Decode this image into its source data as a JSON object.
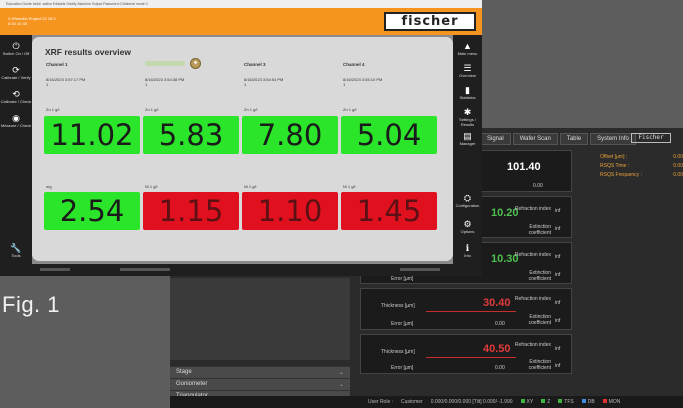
{
  "figure_label": "Fig. 1",
  "foreground": {
    "top_strip": "Education  Guide  #### -active                                                                                                            Editable  Oddity  Machine  Output  Password  0   Material mode  0",
    "header_datetime": [
      "C:\\Results\\  Project 22 18 0",
      "0:33 10 45"
    ],
    "logo_text": "fischer",
    "left_sidebar": [
      {
        "icon": "power-icon",
        "glyph": "⏻",
        "label": "Switch On / Off"
      },
      {
        "icon": "calibrate-icon",
        "glyph": "⟳",
        "label": "Calibrate / Verify"
      },
      {
        "icon": "calibrate-check-icon",
        "glyph": "⟲",
        "label": "Calibrate / Check"
      },
      {
        "icon": "measure-icon",
        "glyph": "◉",
        "label": "Measure / Check"
      },
      {
        "icon": "wrench-icon",
        "glyph": "🔧",
        "label": "Tools"
      }
    ],
    "right_sidebar": [
      {
        "icon": "main-menu-icon",
        "glyph": "▲",
        "label": "Main menu"
      },
      {
        "icon": "list-icon",
        "glyph": "☰",
        "label": "Overview"
      },
      {
        "icon": "chart-icon",
        "glyph": "▮",
        "label": "Statistics"
      },
      {
        "icon": "settings-icon",
        "glyph": "✱",
        "label": "Settings / Results"
      },
      {
        "icon": "save-icon",
        "glyph": "▤",
        "label": "Manager"
      },
      {
        "icon": "configuration-icon",
        "glyph": "⛭",
        "label": "Configuration"
      },
      {
        "icon": "gear-icon",
        "glyph": "⚙",
        "label": "Options"
      },
      {
        "icon": "info-icon",
        "glyph": "ℹ",
        "label": "Info"
      }
    ],
    "results": {
      "title": "XRF results overview",
      "channels": [
        {
          "name": "Channel 1",
          "date": "8/16/2023 3:57:17 PM",
          "index": "1"
        },
        {
          "name": "",
          "date": "8/16/2023 3:54:38 PM",
          "index": "1"
        },
        {
          "name": "Channel 3",
          "date": "8/16/2023 3:54:54 PM",
          "index": "1"
        },
        {
          "name": "Channel 4",
          "date": "8/16/2023 3:55:10 PM",
          "index": "1"
        }
      ],
      "row1": [
        {
          "label": "Zn 1   g/l",
          "value": "11.02",
          "status": "green"
        },
        {
          "label": "Zn 1   g/l",
          "value": "5.83",
          "status": "green"
        },
        {
          "label": "Zn 1   g/l",
          "value": "7.80",
          "status": "green"
        },
        {
          "label": "Zn 1   g/l",
          "value": "5.04",
          "status": "green"
        }
      ],
      "row2": [
        {
          "label": "mg",
          "value": "2.54",
          "status": "green"
        },
        {
          "label": "Ni 1   g/l",
          "value": "1.15",
          "status": "red"
        },
        {
          "label": "Ni 1   g/l",
          "value": "1.10",
          "status": "red"
        },
        {
          "label": "Ni 1   g/l",
          "value": "1.45",
          "status": "red"
        }
      ]
    },
    "colors": {
      "header": "#f59520",
      "ok": "#2be52b",
      "fail": "#e1101e"
    }
  },
  "background": {
    "tabs": [
      "Signal",
      "Wafer Scan",
      "Table",
      "System Info"
    ],
    "logo_text": "Fischer",
    "info": [
      {
        "label": "Offset [µm] :",
        "value": "0.00"
      },
      {
        "label": "RSQS Time :",
        "value": "0.00"
      },
      {
        "label": "RSQS Frequency :",
        "value": "0.00"
      }
    ],
    "cards": [
      {
        "big": "101.40",
        "small": "0.00"
      },
      {
        "value": "10.20",
        "color": "green",
        "lbl1": "Refraction index",
        "u1": "inf",
        "lbl2": "Extinction coefficient",
        "u2": "inf"
      },
      {
        "value": "10.30",
        "color": "green",
        "thick": "",
        "err": "Error [µm]",
        "lbl1": "Refraction index",
        "u1": "inf",
        "lbl2": "Extinction coefficient",
        "u2": "inf"
      },
      {
        "value": "30.40",
        "color": "red",
        "thick": "Thickness [µm]",
        "err": "Error [µm]",
        "errval": "0.00",
        "lbl1": "Refraction index",
        "u1": "inf",
        "lbl2": "Extinction coefficient",
        "u2": "inf"
      },
      {
        "value": "40.50",
        "color": "red",
        "thick": "Thickness [µm]",
        "err": "Error [µm]",
        "errval": "0.00",
        "lbl1": "Refraction index",
        "u1": "inf",
        "lbl2": "Extinction coefficient",
        "u2": "inf"
      }
    ],
    "accordion": [
      "Stage",
      "Goniometer",
      "Triangulator"
    ],
    "status": {
      "user_role_label": "User Role :",
      "user_role": "Customer",
      "coords": "0.000/0.000/0.000  [Tilt]  0.000/ -1.990",
      "leds": [
        {
          "label": "XY",
          "color": "#3fb53f"
        },
        {
          "label": "Z",
          "color": "#3fb53f"
        },
        {
          "label": "TFS",
          "color": "#3fb53f"
        },
        {
          "label": "DB",
          "color": "#3a8ee0"
        },
        {
          "label": "MON",
          "color": "#d33"
        }
      ]
    }
  }
}
